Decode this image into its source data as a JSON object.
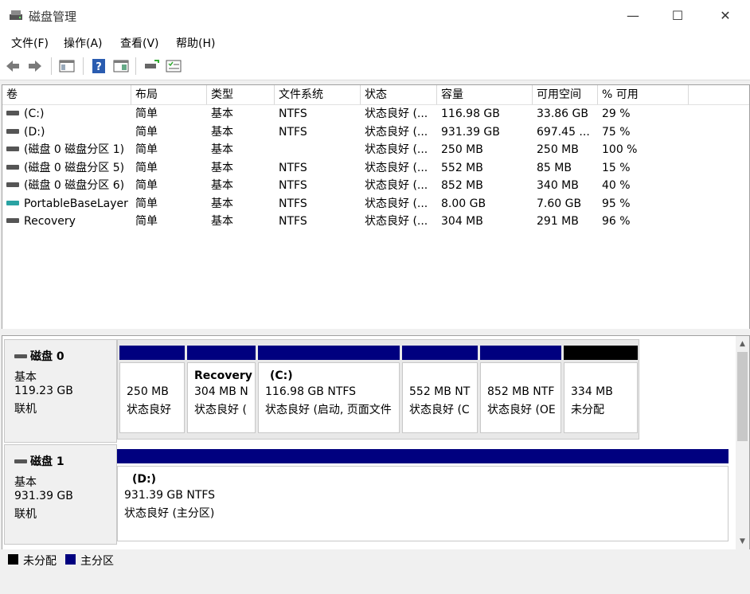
{
  "window": {
    "title": "磁盘管理",
    "minimize": "—",
    "maximize": "☐",
    "close": "✕"
  },
  "menu": [
    "文件(F)",
    "操作(A)",
    "查看(V)",
    "帮助(H)"
  ],
  "volumes": {
    "headers": [
      "卷",
      "布局",
      "类型",
      "文件系统",
      "状态",
      "容量",
      "可用空间",
      "% 可用"
    ],
    "rows": [
      {
        "name": "(C:)",
        "layout": "简单",
        "type": "基本",
        "fs": "NTFS",
        "status": "状态良好 (...",
        "capacity": "116.98 GB",
        "free": "33.86 GB",
        "pct": "29 %",
        "icon": "drive-icon"
      },
      {
        "name": "(D:)",
        "layout": "简单",
        "type": "基本",
        "fs": "NTFS",
        "status": "状态良好 (...",
        "capacity": "931.39 GB",
        "free": "697.45 ...",
        "pct": "75 %",
        "icon": "drive-icon"
      },
      {
        "name": "(磁盘 0 磁盘分区 1)",
        "layout": "简单",
        "type": "基本",
        "fs": "",
        "status": "状态良好 (...",
        "capacity": "250 MB",
        "free": "250 MB",
        "pct": "100 %",
        "icon": "drive-icon"
      },
      {
        "name": "(磁盘 0 磁盘分区 5)",
        "layout": "简单",
        "type": "基本",
        "fs": "NTFS",
        "status": "状态良好 (...",
        "capacity": "552 MB",
        "free": "85 MB",
        "pct": "15 %",
        "icon": "drive-icon"
      },
      {
        "name": "(磁盘 0 磁盘分区 6)",
        "layout": "简单",
        "type": "基本",
        "fs": "NTFS",
        "status": "状态良好 (...",
        "capacity": "852 MB",
        "free": "340 MB",
        "pct": "40 %",
        "icon": "drive-icon"
      },
      {
        "name": "PortableBaseLayer",
        "layout": "简单",
        "type": "基本",
        "fs": "NTFS",
        "status": "状态良好 (...",
        "capacity": "8.00 GB",
        "free": "7.60 GB",
        "pct": "95 %",
        "icon": "teal-drive-icon"
      },
      {
        "name": "Recovery",
        "layout": "简单",
        "type": "基本",
        "fs": "NTFS",
        "status": "状态良好 (...",
        "capacity": "304 MB",
        "free": "291 MB",
        "pct": "96 %",
        "icon": "drive-icon"
      }
    ]
  },
  "disks": [
    {
      "name": "磁盘 0",
      "kind": "基本",
      "size": "119.23 GB",
      "state": "联机",
      "partitions": [
        {
          "title": "",
          "line1": "250 MB",
          "line2": "状态良好",
          "bar": "primary"
        },
        {
          "title": "Recovery",
          "line1": "304 MB N",
          "line2": "状态良好 (",
          "bar": "primary"
        },
        {
          "title": "(C:)",
          "line1": "116.98 GB NTFS",
          "line2": "状态良好 (启动, 页面文件",
          "bar": "primary"
        },
        {
          "title": "",
          "line1": "552 MB NT",
          "line2": "状态良好 (C",
          "bar": "primary"
        },
        {
          "title": "",
          "line1": "852 MB NTF",
          "line2": "状态良好 (OE",
          "bar": "primary"
        },
        {
          "title": "",
          "line1": "334 MB",
          "line2": "未分配",
          "bar": "unallocated"
        }
      ]
    },
    {
      "name": "磁盘 1",
      "kind": "基本",
      "size": "931.39 GB",
      "state": "联机",
      "partitions": [
        {
          "title": "(D:)",
          "line1": "931.39 GB NTFS",
          "line2": "状态良好 (主分区)",
          "bar": "primary"
        }
      ]
    }
  ],
  "legend": {
    "unallocated": "未分配",
    "primary": "主分区"
  },
  "colors": {
    "primary": "#00007f",
    "unallocated": "#000000",
    "window_bg": "#f0f0f0"
  }
}
